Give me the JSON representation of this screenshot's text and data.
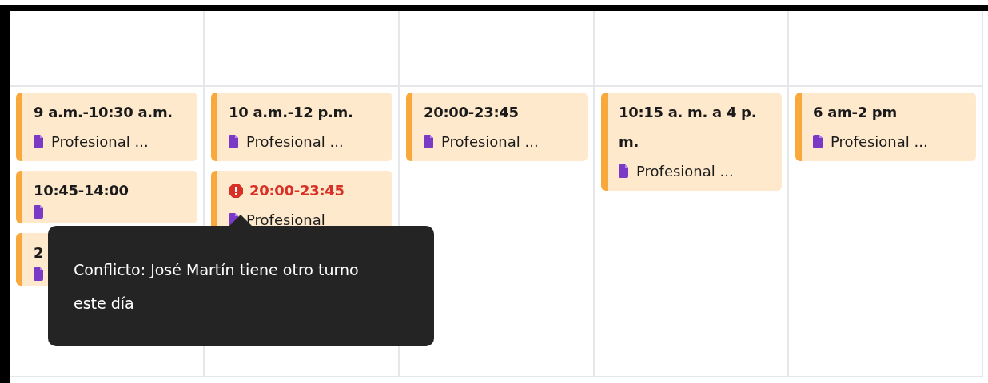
{
  "days": [
    {
      "shifts": [
        {
          "time": "9 a.m.-10:30 a.m.",
          "description": "Profesional ...",
          "conflict": false
        },
        {
          "time": "10:45-14:00",
          "conflict": false
        },
        {
          "time": "2",
          "conflict": false
        }
      ]
    },
    {
      "shifts": [
        {
          "time": "10 a.m.-12 p.m.",
          "description": "Profesional ...",
          "conflict": false
        },
        {
          "time": "20:00-23:45",
          "description": "Profesional",
          "conflict": true
        }
      ]
    },
    {
      "shifts": [
        {
          "time": "20:00-23:45",
          "description": "Profesional ...",
          "conflict": false
        }
      ]
    },
    {
      "shifts": [
        {
          "time": "10:15 a. m. a 4 p. m.",
          "description": "Profesional ...",
          "conflict": false
        }
      ]
    },
    {
      "shifts": [
        {
          "time": "6 am-2 pm",
          "description": "Profesional ...",
          "conflict": false
        }
      ]
    }
  ],
  "tooltip": {
    "text": "Conflicto: José Martín tiene otro turno este día"
  }
}
